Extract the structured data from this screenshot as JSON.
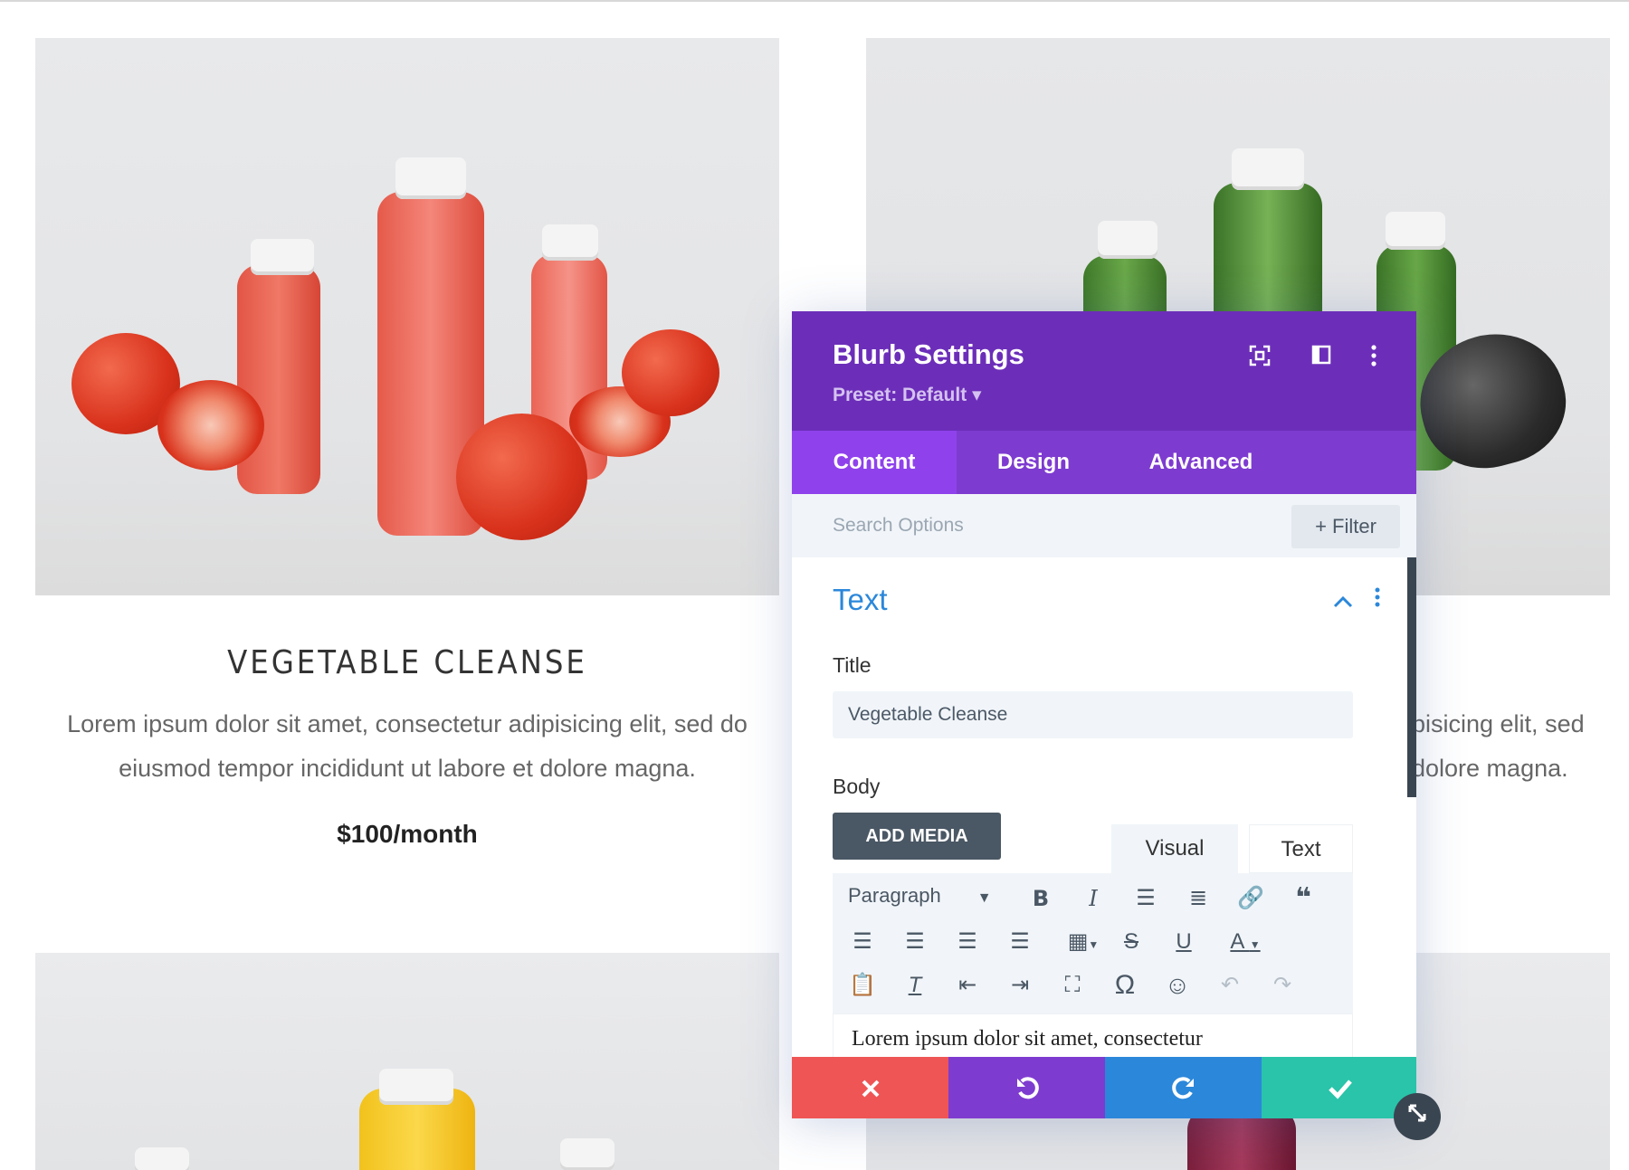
{
  "cards": {
    "left": {
      "title": "VEGETABLE CLEANSE",
      "text": "Lorem ipsum dolor sit amet, consectetur adipisicing elit, sed do eiusmod tempor incididunt ut labore et dolore magna.",
      "price": "$100/month"
    },
    "right": {
      "text_line1": "bisicing elit, sed",
      "text_line2": "dolore magna."
    }
  },
  "modal": {
    "title": "Blurb Settings",
    "preset": "Preset: Default ▾",
    "header_icons": [
      "focus-icon",
      "split-view-icon",
      "more-vertical-icon"
    ],
    "tabs": [
      "Content",
      "Design",
      "Advanced"
    ],
    "active_tab": "Content",
    "search": {
      "placeholder": "Search Options",
      "filter_label": "+ Filter"
    },
    "section": {
      "title": "Text"
    },
    "title_field": {
      "label": "Title",
      "value": "Vegetable Cleanse"
    },
    "body": {
      "label": "Body",
      "add_media": "ADD MEDIA",
      "editor_tabs": [
        "Visual",
        "Text"
      ],
      "format_select": "Paragraph",
      "toolbar_icons": [
        "bold-icon",
        "italic-icon",
        "bullet-list-icon",
        "numbered-list-icon",
        "link-icon",
        "blockquote-icon",
        "align-left-icon",
        "align-center-icon",
        "align-right-icon",
        "justify-icon",
        "table-icon",
        "strikethrough-icon",
        "underline-icon",
        "text-color-icon",
        "paste-icon",
        "clear-format-icon",
        "outdent-icon",
        "indent-icon",
        "fullscreen-icon",
        "special-char-icon",
        "emoji-icon",
        "undo-icon",
        "redo-icon"
      ],
      "editor_text": "Lorem ipsum dolor sit amet, consectetur"
    },
    "actions": [
      {
        "name": "cancel",
        "icon": "close-icon",
        "color": "#ef5555"
      },
      {
        "name": "undo",
        "icon": "undo-icon",
        "color": "#7e3bd0"
      },
      {
        "name": "redo",
        "icon": "redo-icon",
        "color": "#2b87da"
      },
      {
        "name": "save",
        "icon": "check-icon",
        "color": "#29c4a9"
      }
    ]
  },
  "colors": {
    "header": "#6c2eb9",
    "tabs": "#7e3bd0",
    "active_tab": "#8f42ec",
    "accent_blue": "#2b87da"
  }
}
